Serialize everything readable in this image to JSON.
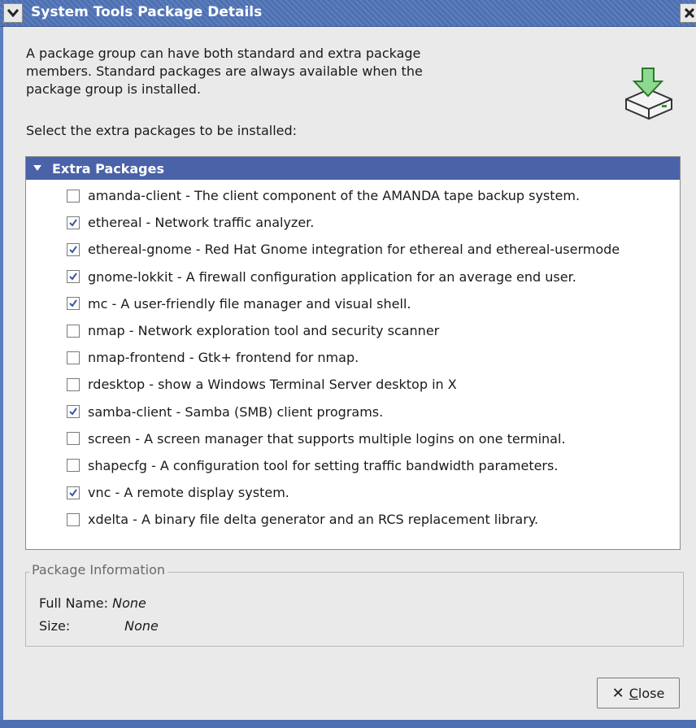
{
  "window": {
    "title": "System Tools Package Details"
  },
  "intro": {
    "line1": "A package group can have both standard and extra package",
    "line2": "members.  Standard packages are always available when the",
    "line3": "package group is installed."
  },
  "select_label": "Select the extra packages to be installed:",
  "list": {
    "header": "Extra Packages",
    "items": [
      {
        "label": "amanda-client - The client component of the AMANDA tape backup system.",
        "checked": false
      },
      {
        "label": "ethereal - Network traffic analyzer.",
        "checked": true
      },
      {
        "label": "ethereal-gnome - Red Hat Gnome integration for ethereal and ethereal-usermode",
        "checked": true
      },
      {
        "label": "gnome-lokkit - A firewall configuration application for an average end user.",
        "checked": true
      },
      {
        "label": "mc - A user-friendly file manager and visual shell.",
        "checked": true
      },
      {
        "label": "nmap - Network exploration tool and security scanner",
        "checked": false
      },
      {
        "label": "nmap-frontend - Gtk+ frontend for nmap.",
        "checked": false
      },
      {
        "label": "rdesktop - show a Windows Terminal Server desktop in X",
        "checked": false
      },
      {
        "label": "samba-client - Samba (SMB) client programs.",
        "checked": true
      },
      {
        "label": "screen - A screen manager that supports multiple logins on one terminal.",
        "checked": false
      },
      {
        "label": "shapecfg - A configuration tool for setting traffic bandwidth parameters.",
        "checked": false
      },
      {
        "label": "vnc - A remote display system.",
        "checked": true
      },
      {
        "label": "xdelta - A binary file delta generator and an RCS replacement library.",
        "checked": false
      }
    ]
  },
  "package_info": {
    "legend": "Package Information",
    "full_name_label": "Full Name:",
    "full_name_value": "None",
    "size_label": "Size:",
    "size_value": "None"
  },
  "buttons": {
    "close_prefix": "",
    "close_mnemonic": "C",
    "close_rest": "lose"
  }
}
